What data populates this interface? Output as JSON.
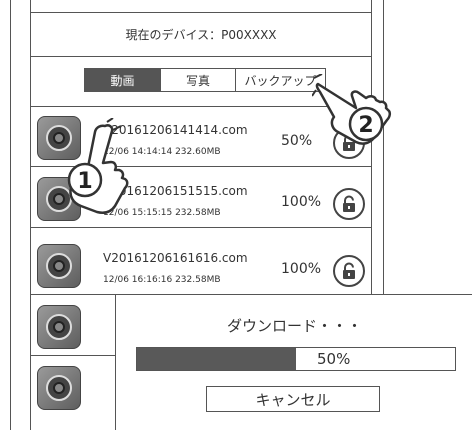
{
  "device": {
    "label": "現在のデバイス：P00XXXX"
  },
  "tabs": [
    {
      "label": "動画",
      "active": true
    },
    {
      "label": "写真",
      "active": false
    },
    {
      "label": "バックアップ",
      "active": false
    }
  ],
  "files": [
    {
      "name": "V20161206141414.com",
      "meta": "12/06 14:14:14 232.60MB",
      "percent": "50%"
    },
    {
      "name": "V20161206151515.com",
      "meta": "12/06 15:15:15 232.58MB",
      "percent": "100%"
    },
    {
      "name": "V20161206161616.com",
      "meta": "12/06 16:16:16 232.58MB",
      "percent": "100%"
    }
  ],
  "dialog": {
    "title": "ダウンロード・・・",
    "progress_label": "50%",
    "progress_value": 0.5,
    "cancel_label": "キャンセル"
  },
  "annotations": {
    "step1": "1",
    "step2": "2"
  },
  "colors": {
    "line": "#555555",
    "active_tab": "#555555",
    "progress_fill": "#595959"
  }
}
